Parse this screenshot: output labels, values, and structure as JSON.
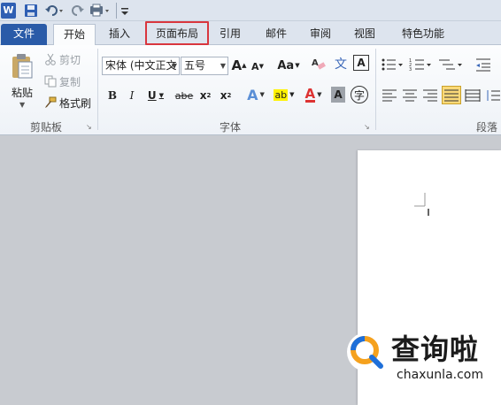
{
  "qat": {
    "app_icon_label": "W",
    "icons": [
      "word-icon",
      "save-icon",
      "undo-icon",
      "redo-icon",
      "print-preview-icon",
      "customize-icon"
    ]
  },
  "tabs": {
    "file": "文件",
    "home": "开始",
    "insert": "插入",
    "page_layout": "页面布局",
    "references": "引用",
    "mailings": "邮件",
    "review": "审阅",
    "view": "视图",
    "special": "特色功能"
  },
  "clipboard": {
    "paste_label": "粘贴",
    "cut_label": "剪切",
    "copy_label": "复制",
    "format_painter_label": "格式刷",
    "group_label": "剪贴板"
  },
  "font": {
    "font_name": "宋体 (中文正文",
    "font_size": "五号",
    "grow_label": "A",
    "shrink_label": "A",
    "change_case_label": "Aa",
    "bold": "B",
    "italic": "I",
    "underline": "U",
    "strike": "abe",
    "subscript": "x",
    "superscript": "x",
    "text_effects": "A",
    "highlight": "ab",
    "font_color": "A",
    "char_shading": "A",
    "enclose_char": "字",
    "phonetic": "文",
    "char_border": "A",
    "group_label": "字体"
  },
  "paragraph": {
    "group_label": "段落"
  },
  "watermark": {
    "title": "查询啦",
    "url": "chaxunla.com"
  },
  "colors": {
    "accent_red": "#d9363e",
    "file_tab": "#2a5ba8",
    "ribbon_bg": "#f4f7fb"
  }
}
